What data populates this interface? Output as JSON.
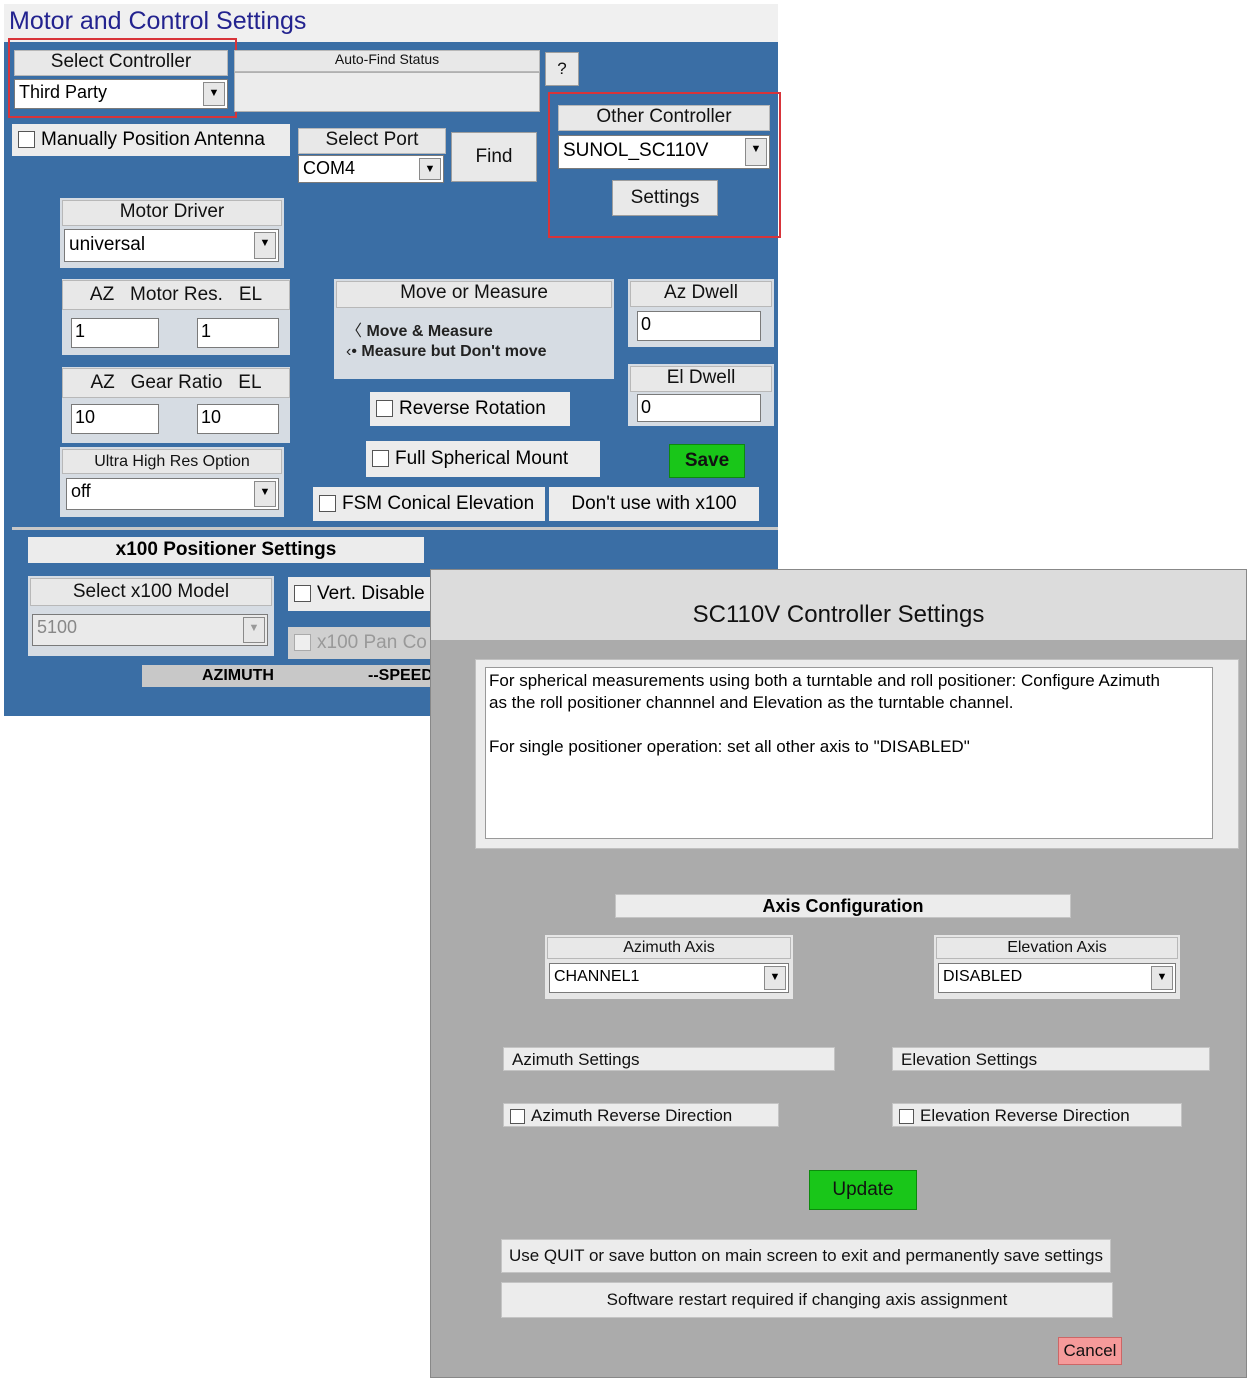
{
  "main": {
    "title": "Motor and Control Settings",
    "select_controller": {
      "label": "Select Controller",
      "value": "Third Party"
    },
    "auto_find_status": {
      "label": "Auto-Find Status"
    },
    "help_label": "?",
    "manual_position": {
      "label": "Manually Position Antenna"
    },
    "select_port": {
      "label": "Select Port",
      "value": "COM4"
    },
    "find_label": "Find",
    "other_controller": {
      "label": "Other Controller",
      "value": "SUNOL_SC110V",
      "settings_label": "Settings"
    },
    "motor_driver": {
      "label": "Motor Driver",
      "value": "universal"
    },
    "motor_res": {
      "az": "AZ",
      "label": "Motor Res.",
      "el": "EL",
      "az_value": "1",
      "el_value": "1"
    },
    "gear_ratio": {
      "az": "AZ",
      "label": "Gear Ratio",
      "el": "EL",
      "az_value": "10",
      "el_value": "10"
    },
    "ultra_high_res": {
      "label": "Ultra High Res Option",
      "value": "off"
    },
    "move_or_measure": {
      "label": "Move or Measure",
      "option1": "Move & Measure",
      "option2": "Measure but Don't move"
    },
    "az_dwell": {
      "label": "Az Dwell",
      "value": "0"
    },
    "el_dwell": {
      "label": "El Dwell",
      "value": "0"
    },
    "reverse_rotation": "Reverse Rotation",
    "full_spherical": "Full Spherical Mount",
    "save_label": "Save",
    "fsm_conical": "FSM Conical Elevation",
    "dont_use": "Don't use with x100",
    "x100_settings": "x100 Positioner Settings",
    "select_x100_model": {
      "label": "Select x100 Model",
      "value": "5100"
    },
    "vert_disable": "Vert. Disable",
    "x100_pan": "x100 Pan Co",
    "azimuth_col": "AZIMUTH",
    "speed_col": "--SPEED"
  },
  "dialog": {
    "title": "SC110V Controller Settings",
    "info_line1": "For spherical measurements using both a turntable and roll positioner: Configure Azimuth",
    "info_line2": "as the roll positioner channnel and Elevation as the turntable channel.",
    "info_line3": "For single positioner operation: set all other axis to \"DISABLED\"",
    "axis_config": "Axis Configuration",
    "azimuth_axis": {
      "label": "Azimuth Axis",
      "value": "CHANNEL1"
    },
    "elevation_axis": {
      "label": "Elevation Axis",
      "value": "DISABLED"
    },
    "azimuth_settings": "Azimuth Settings",
    "elevation_settings": "Elevation Settings",
    "azimuth_reverse": "Azimuth Reverse Direction",
    "elevation_reverse": "Elevation Reverse Direction",
    "update_label": "Update",
    "quit_note": "Use QUIT or save button on main screen to exit and permanently save settings",
    "restart_note": "Software restart required if changing axis assignment",
    "cancel_label": "Cancel"
  },
  "colors": {
    "window_blue": "#3a6ea5",
    "save_green": "#19c619",
    "cancel_red": "#f59a9a",
    "highlight_red": "#d8343a"
  }
}
